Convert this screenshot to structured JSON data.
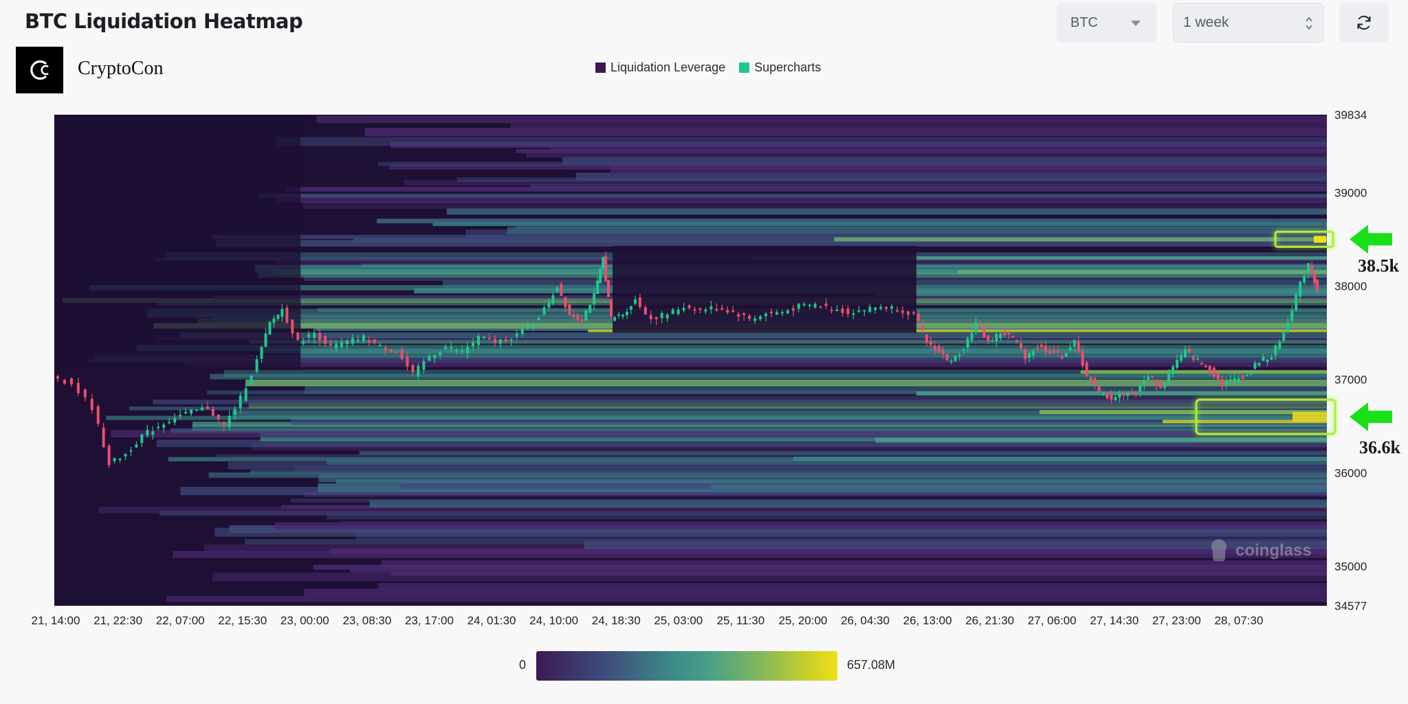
{
  "header": {
    "title": "BTC Liquidation Heatmap",
    "coin_select": {
      "value": "BTC"
    },
    "range_select": {
      "value": "1 week"
    }
  },
  "brand": {
    "name": "CryptoCon"
  },
  "legend": [
    {
      "label": "Liquidation Leverage",
      "color": "#3d1750"
    },
    {
      "label": "Supercharts",
      "color": "#1fc98a"
    }
  ],
  "colorbar": {
    "min_label": "0",
    "max_label": "657.08M"
  },
  "watermark": "coinglass",
  "annotations": [
    {
      "label": "38.5k",
      "price": 38500
    },
    {
      "label": "36.6k",
      "price": 36600
    }
  ],
  "chart_data": {
    "type": "heatmap",
    "title": "BTC Liquidation Heatmap",
    "x_ticks": [
      "21, 14:00",
      "21, 22:30",
      "22, 07:00",
      "22, 15:30",
      "23, 00:00",
      "23, 08:30",
      "23, 17:00",
      "24, 01:30",
      "24, 10:00",
      "24, 18:30",
      "25, 03:00",
      "25, 11:30",
      "25, 20:00",
      "26, 04:30",
      "26, 13:00",
      "26, 21:30",
      "27, 06:00",
      "27, 14:30",
      "27, 23:00",
      "28, 07:30"
    ],
    "y_ticks": [
      39834,
      39000,
      38000,
      37000,
      36000,
      35000,
      34577
    ],
    "ylim": [
      34577,
      39834
    ],
    "color_scale": {
      "min": 0,
      "max_label": "657.08M",
      "colors": [
        "#3b1a54",
        "#3f4a7a",
        "#3b8a88",
        "#4aa088",
        "#86b85a",
        "#c9cf2a",
        "#f0df18"
      ]
    },
    "price_series": [
      {
        "t": 0.0,
        "p": 37050
      },
      {
        "t": 0.5,
        "p": 36950
      },
      {
        "t": 1.0,
        "p": 36700
      },
      {
        "t": 1.4,
        "p": 36100
      },
      {
        "t": 1.8,
        "p": 36200
      },
      {
        "t": 2.2,
        "p": 36400
      },
      {
        "t": 2.6,
        "p": 36500
      },
      {
        "t": 3.0,
        "p": 36600
      },
      {
        "t": 3.4,
        "p": 36650
      },
      {
        "t": 3.8,
        "p": 36700
      },
      {
        "t": 4.2,
        "p": 36500
      },
      {
        "t": 4.6,
        "p": 36800
      },
      {
        "t": 5.0,
        "p": 37200
      },
      {
        "t": 5.3,
        "p": 37600
      },
      {
        "t": 5.6,
        "p": 37750
      },
      {
        "t": 6.0,
        "p": 37400
      },
      {
        "t": 6.4,
        "p": 37500
      },
      {
        "t": 6.8,
        "p": 37350
      },
      {
        "t": 7.2,
        "p": 37400
      },
      {
        "t": 7.6,
        "p": 37450
      },
      {
        "t": 8.0,
        "p": 37350
      },
      {
        "t": 8.4,
        "p": 37300
      },
      {
        "t": 8.8,
        "p": 37050
      },
      {
        "t": 9.2,
        "p": 37250
      },
      {
        "t": 9.6,
        "p": 37350
      },
      {
        "t": 10.0,
        "p": 37300
      },
      {
        "t": 10.4,
        "p": 37450
      },
      {
        "t": 10.8,
        "p": 37400
      },
      {
        "t": 11.2,
        "p": 37450
      },
      {
        "t": 11.6,
        "p": 37550
      },
      {
        "t": 12.0,
        "p": 37750
      },
      {
        "t": 12.3,
        "p": 38000
      },
      {
        "t": 12.6,
        "p": 37700
      },
      {
        "t": 12.9,
        "p": 37650
      },
      {
        "t": 13.2,
        "p": 37900
      },
      {
        "t": 13.4,
        "p": 38300
      },
      {
        "t": 13.6,
        "p": 37650
      },
      {
        "t": 13.9,
        "p": 37700
      },
      {
        "t": 14.2,
        "p": 37850
      },
      {
        "t": 14.6,
        "p": 37650
      },
      {
        "t": 15.0,
        "p": 37700
      },
      {
        "t": 15.4,
        "p": 37780
      },
      {
        "t": 15.8,
        "p": 37750
      },
      {
        "t": 16.2,
        "p": 37770
      },
      {
        "t": 16.6,
        "p": 37720
      },
      {
        "t": 17.0,
        "p": 37650
      },
      {
        "t": 17.4,
        "p": 37700
      },
      {
        "t": 17.8,
        "p": 37720
      },
      {
        "t": 18.2,
        "p": 37780
      },
      {
        "t": 18.6,
        "p": 37800
      },
      {
        "t": 19.0,
        "p": 37760
      },
      {
        "t": 19.4,
        "p": 37720
      },
      {
        "t": 19.8,
        "p": 37750
      },
      {
        "t": 20.2,
        "p": 37780
      },
      {
        "t": 20.6,
        "p": 37760
      },
      {
        "t": 21.0,
        "p": 37700
      },
      {
        "t": 21.3,
        "p": 37400
      },
      {
        "t": 21.6,
        "p": 37300
      },
      {
        "t": 21.9,
        "p": 37180
      },
      {
        "t": 22.2,
        "p": 37350
      },
      {
        "t": 22.5,
        "p": 37600
      },
      {
        "t": 22.8,
        "p": 37400
      },
      {
        "t": 23.1,
        "p": 37500
      },
      {
        "t": 23.4,
        "p": 37450
      },
      {
        "t": 23.7,
        "p": 37250
      },
      {
        "t": 24.0,
        "p": 37350
      },
      {
        "t": 24.3,
        "p": 37300
      },
      {
        "t": 24.6,
        "p": 37250
      },
      {
        "t": 24.9,
        "p": 37400
      },
      {
        "t": 25.2,
        "p": 37050
      },
      {
        "t": 25.5,
        "p": 36850
      },
      {
        "t": 25.8,
        "p": 36800
      },
      {
        "t": 26.1,
        "p": 36850
      },
      {
        "t": 26.4,
        "p": 36850
      },
      {
        "t": 26.7,
        "p": 37050
      },
      {
        "t": 27.0,
        "p": 36900
      },
      {
        "t": 27.3,
        "p": 37150
      },
      {
        "t": 27.6,
        "p": 37300
      },
      {
        "t": 27.9,
        "p": 37200
      },
      {
        "t": 28.2,
        "p": 37100
      },
      {
        "t": 28.5,
        "p": 36950
      },
      {
        "t": 28.8,
        "p": 37000
      },
      {
        "t": 29.1,
        "p": 37050
      },
      {
        "t": 29.4,
        "p": 37200
      },
      {
        "t": 29.7,
        "p": 37250
      },
      {
        "t": 30.0,
        "p": 37500
      },
      {
        "t": 30.3,
        "p": 37900
      },
      {
        "t": 30.6,
        "p": 38250
      },
      {
        "t": 30.8,
        "p": 37950
      }
    ]
  }
}
